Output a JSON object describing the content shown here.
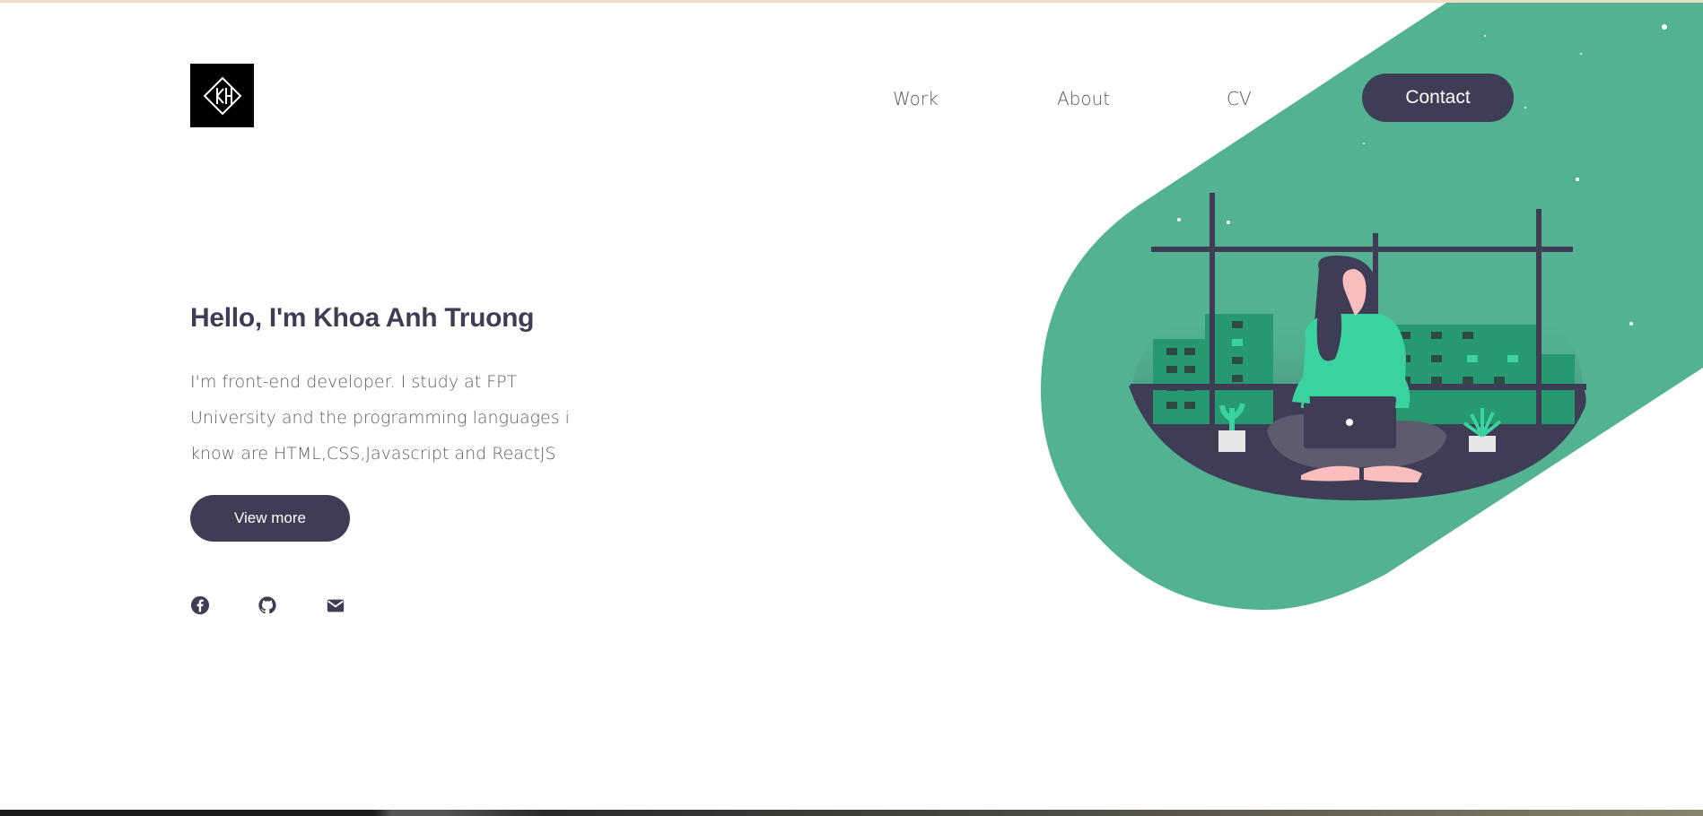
{
  "header": {
    "logo_alt": "KH",
    "nav": {
      "work": "Work",
      "about": "About",
      "cv": "CV",
      "contact": "Contact"
    }
  },
  "hero": {
    "title": "Hello, I'm Khoa Anh Truong",
    "description": "I'm front-end developer. I study at FPT University and the programming languages i know are HTML,CSS,Javascript and ReactJS",
    "view_more": "View more"
  },
  "social": [
    {
      "icon": "facebook-icon"
    },
    {
      "icon": "github-icon"
    },
    {
      "icon": "mail-icon"
    }
  ],
  "colors": {
    "accent_green": "#52b291",
    "dark": "#3f3d56",
    "bright_green": "#3ad29f"
  }
}
